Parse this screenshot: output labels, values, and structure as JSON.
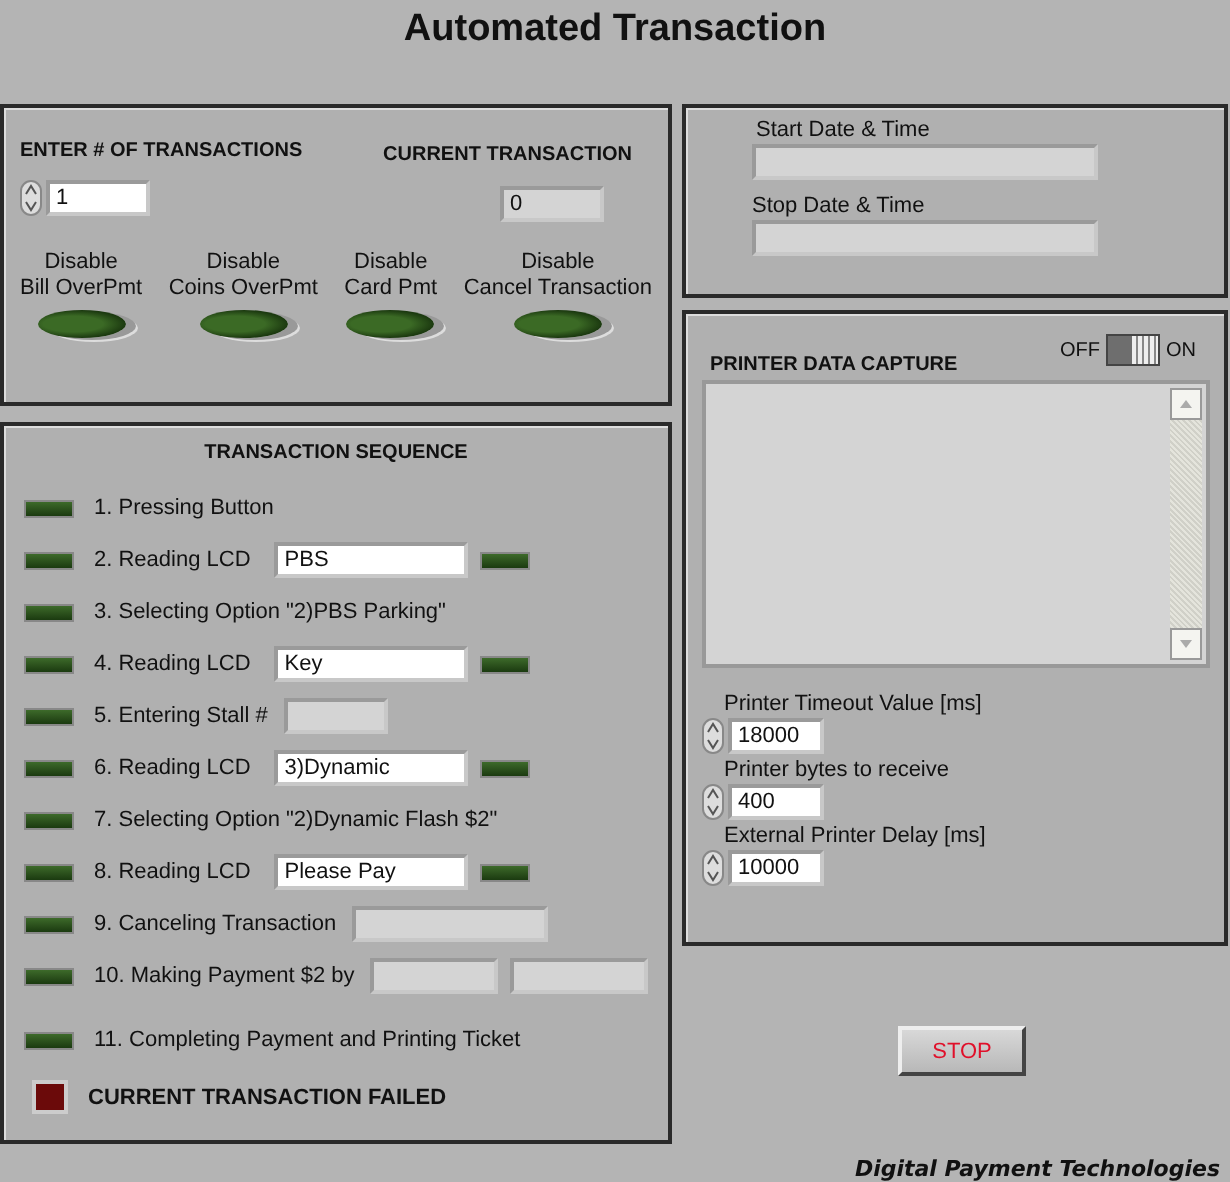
{
  "window": {
    "title": "Automated Transaction"
  },
  "setup": {
    "count_label": "ENTER # OF TRANSACTIONS",
    "count_value": "1",
    "current_label": "CURRENT TRANSACTION",
    "current_value": "0",
    "toggles": [
      {
        "line1": "Disable",
        "line2": "Bill OverPmt",
        "on": false
      },
      {
        "line1": "Disable",
        "line2": "Coins OverPmt",
        "on": false
      },
      {
        "line1": "Disable",
        "line2": "Card Pmt",
        "on": false
      },
      {
        "line1": "Disable",
        "line2": "Cancel Transaction",
        "on": false
      }
    ]
  },
  "sequence": {
    "title": "TRANSACTION SEQUENCE",
    "steps": [
      {
        "kind": "plain",
        "label": "1. Pressing Button",
        "on": false
      },
      {
        "kind": "lcd",
        "label": "2. Reading LCD",
        "value": "PBS",
        "on": false,
        "match_on": false
      },
      {
        "kind": "plain",
        "label": "3. Selecting Option  \"2)PBS Parking\"",
        "on": false
      },
      {
        "kind": "lcd",
        "label": "4. Reading LCD",
        "value": "Key",
        "on": false,
        "match_on": false
      },
      {
        "kind": "stall",
        "label": "5. Entering Stall #",
        "on": false
      },
      {
        "kind": "lcd",
        "label": "6. Reading LCD",
        "value": "3)Dynamic",
        "on": false,
        "match_on": false
      },
      {
        "kind": "plain",
        "label": "7. Selecting Option  \"2)Dynamic Flash $2\"",
        "on": false
      },
      {
        "kind": "lcd",
        "label": "8. Reading LCD",
        "value": "Please Pay",
        "on": false,
        "match_on": false
      },
      {
        "kind": "cancel",
        "label": "9. Canceling Transaction",
        "on": false
      },
      {
        "kind": "payment",
        "label": "10. Making Payment $2 by",
        "on": false
      },
      {
        "kind": "plain",
        "label": "11. Completing Payment and Printing Ticket",
        "on": false
      }
    ],
    "failed": {
      "label": "CURRENT TRANSACTION FAILED",
      "on": false
    }
  },
  "dates": {
    "start_label": "Start Date & Time",
    "stop_label": "Stop Date & Time"
  },
  "printer": {
    "title": "PRINTER DATA CAPTURE",
    "switch": {
      "off_label": "OFF",
      "on_label": "ON",
      "on": true
    },
    "settings": [
      {
        "label": "Printer Timeout Value [ms]",
        "value": "18000"
      },
      {
        "label": "Printer bytes to receive",
        "value": "400"
      },
      {
        "label": "External Printer Delay [ms]",
        "value": "10000"
      }
    ]
  },
  "stop_button": "STOP",
  "footer": "Digital Payment Technologies"
}
